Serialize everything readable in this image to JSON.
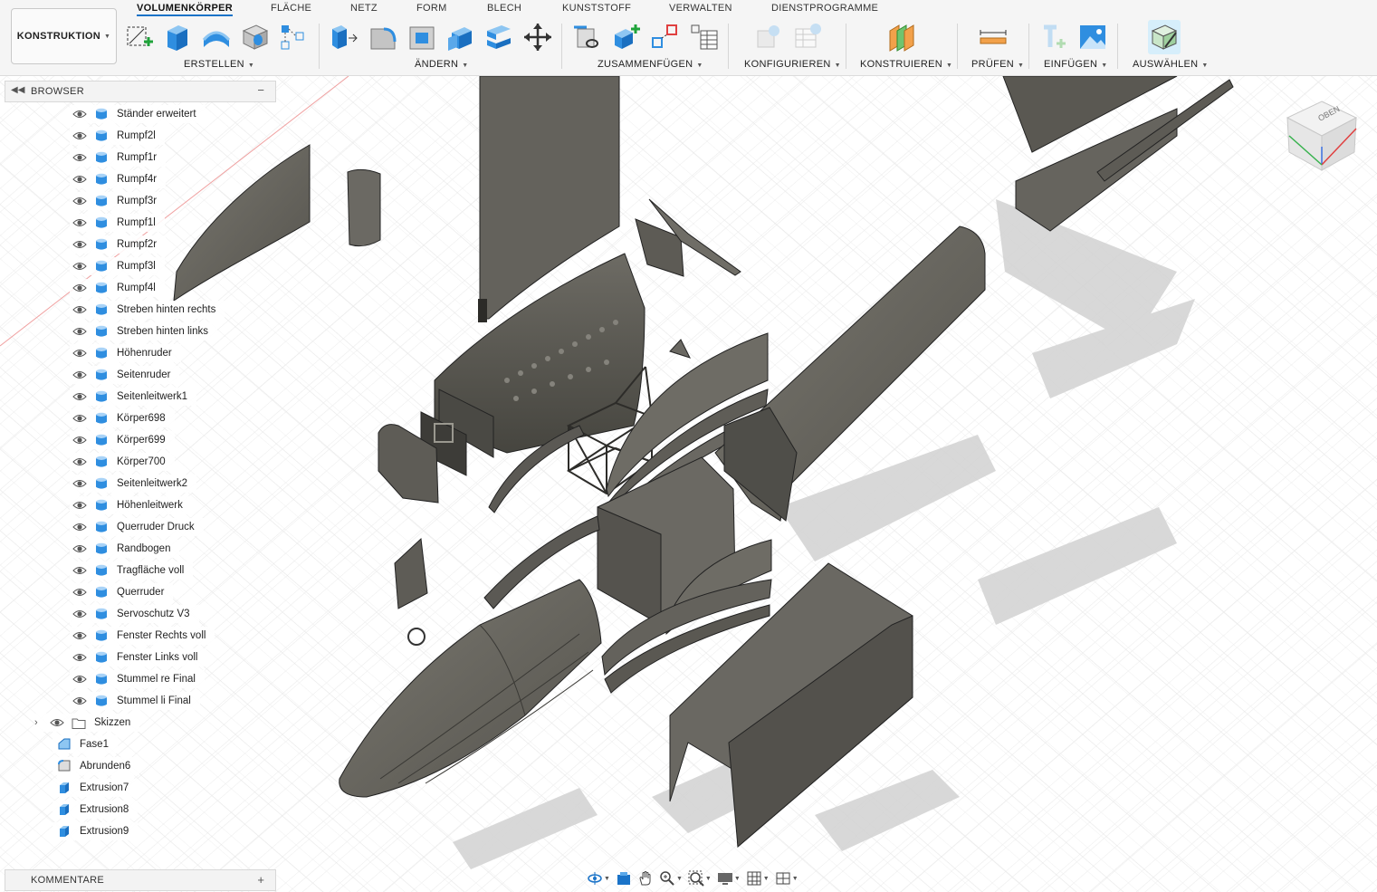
{
  "workspace": {
    "label": "KONSTRUKTION"
  },
  "tabs": [
    {
      "label": "VOLUMENKÖRPER",
      "active": true
    },
    {
      "label": "FLÄCHE"
    },
    {
      "label": "NETZ"
    },
    {
      "label": "FORM"
    },
    {
      "label": "BLECH"
    },
    {
      "label": "KUNSTSTOFF"
    },
    {
      "label": "VERWALTEN"
    },
    {
      "label": "DIENSTPROGRAMME"
    }
  ],
  "groups": [
    {
      "label": "ERSTELLEN"
    },
    {
      "label": "ÄNDERN"
    },
    {
      "label": "ZUSAMMENFÜGEN"
    },
    {
      "label": "KONFIGURIEREN"
    },
    {
      "label": "KONSTRUIEREN"
    },
    {
      "label": "PRÜFEN"
    },
    {
      "label": "EINFÜGEN"
    },
    {
      "label": "AUSWÄHLEN"
    }
  ],
  "browser": {
    "title": "BROWSER",
    "bodies": [
      "Ständer erweitert",
      "Rumpf2l",
      "Rumpf1r",
      "Rumpf4r",
      "Rumpf3r",
      "Rumpf1l",
      "Rumpf2r",
      "Rumpf3l",
      "Rumpf4l",
      "Streben hinten rechts",
      "Streben hinten links",
      "Höhenruder",
      "Seitenruder",
      "Seitenleitwerk1",
      "Körper698",
      "Körper699",
      "Körper700",
      "Seitenleitwerk2",
      "Höhenleitwerk",
      "Querruder Druck",
      "Randbogen",
      "Tragfläche voll",
      "Querruder",
      "Servoschutz V3",
      "Fenster Rechts voll",
      "Fenster Links voll",
      "Stummel re Final",
      "Stummel li Final"
    ],
    "folder": "Skizzen",
    "features": [
      {
        "label": "Fase1",
        "icon": "chamfer-icon"
      },
      {
        "label": "Abrunden6",
        "icon": "fillet-icon"
      },
      {
        "label": "Extrusion7",
        "icon": "extrude-icon"
      },
      {
        "label": "Extrusion8",
        "icon": "extrude-icon"
      },
      {
        "label": "Extrusion9",
        "icon": "extrude-icon"
      }
    ]
  },
  "comments": {
    "title": "KOMMENTARE"
  },
  "viewcube": {
    "face": "OBEN"
  },
  "colors": {
    "accent": "#1a73c8",
    "body": "#64625c",
    "body_dark": "#3f3e3a",
    "body_light": "#7d7b74"
  }
}
